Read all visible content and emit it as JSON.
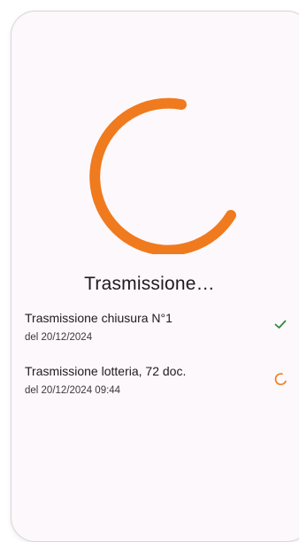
{
  "dialog": {
    "title": "Trasmissione…",
    "accent_color": "#f07a1e",
    "success_color": "#2e8b3e"
  },
  "items": [
    {
      "title": "Trasmissione chiusura N°1",
      "subtitle": "del 20/12/2024",
      "status": "done",
      "status_icon": "check-icon"
    },
    {
      "title": "Trasmissione lotteria, 72 doc.",
      "subtitle": "del 20/12/2024 09:44",
      "status": "in-progress",
      "status_icon": "loading-icon"
    }
  ]
}
